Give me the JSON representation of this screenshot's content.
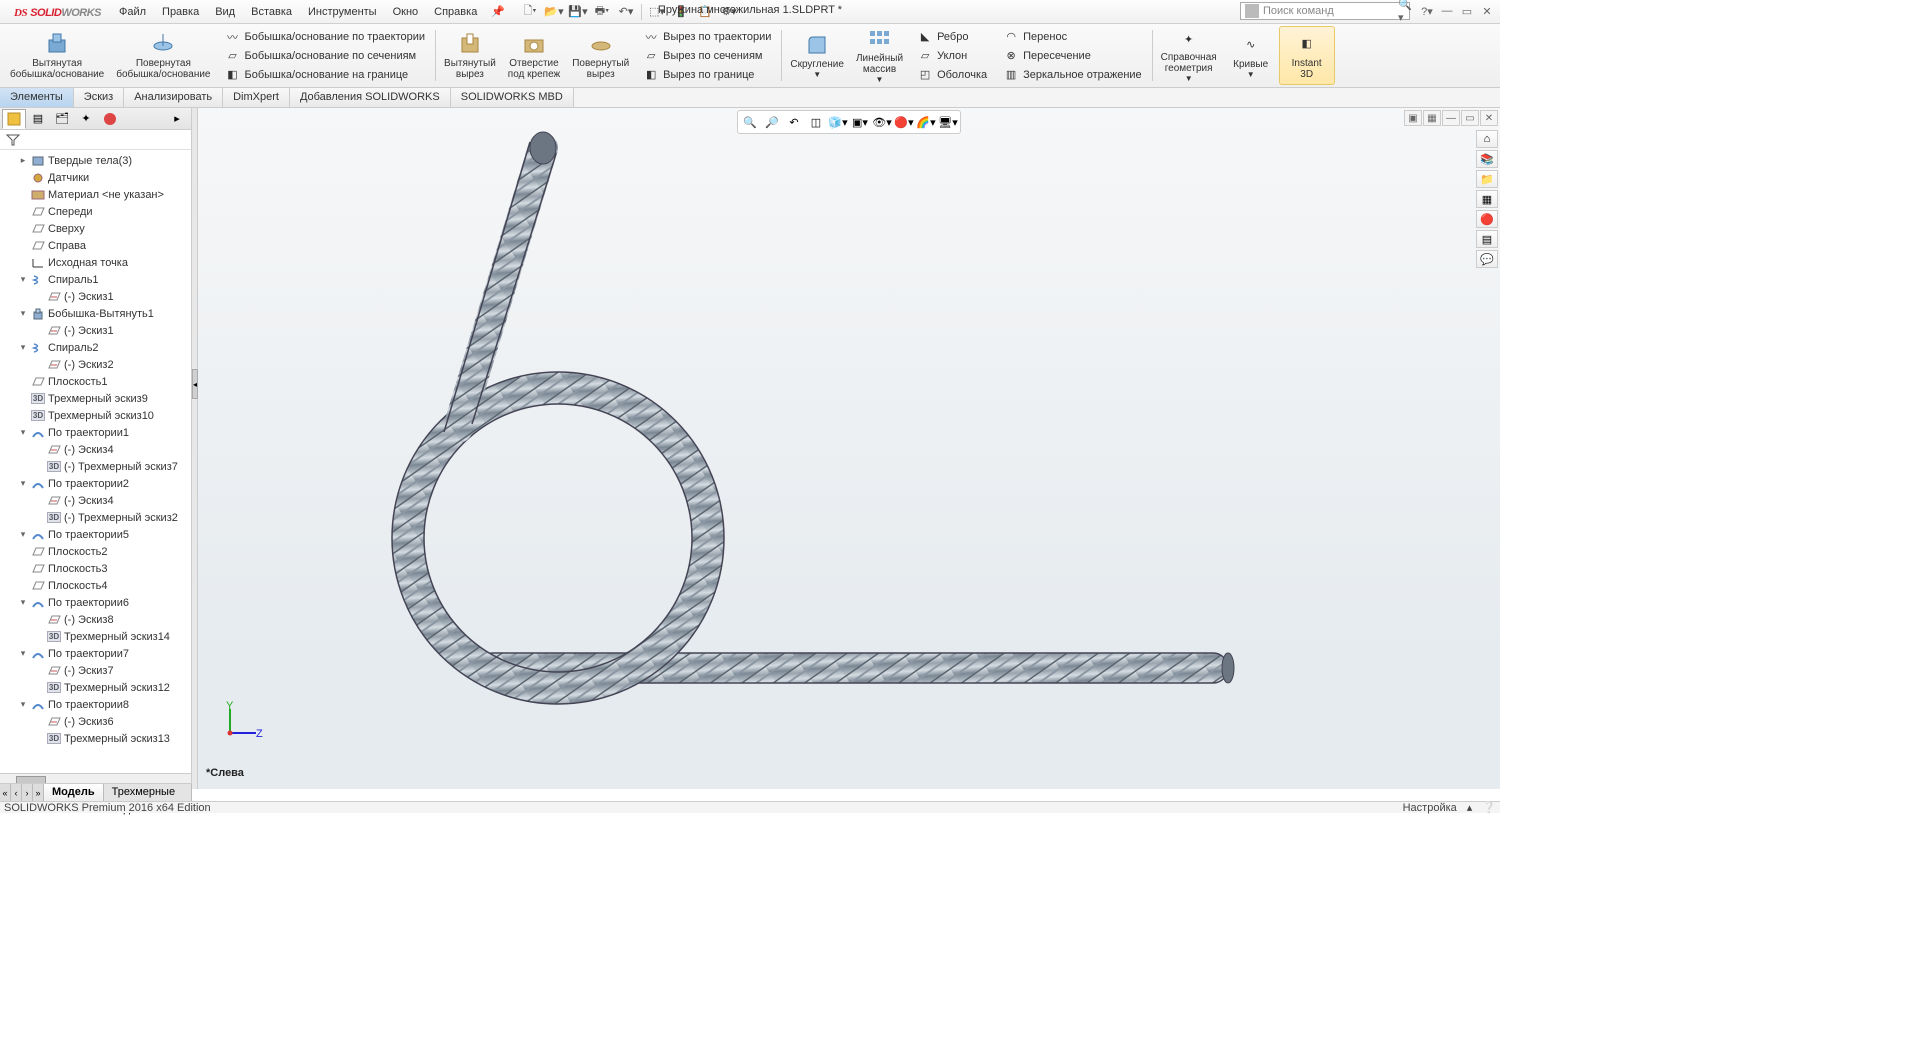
{
  "app": {
    "title": "Пружина многожильная 1.SLDPRT *",
    "logo_ds": "DS",
    "logo_solid": "SOLID",
    "logo_works": "WORKS"
  },
  "menu": [
    "Файл",
    "Правка",
    "Вид",
    "Вставка",
    "Инструменты",
    "Окно",
    "Справка"
  ],
  "search_placeholder": "Поиск команд",
  "ribbon": {
    "big": [
      {
        "label": "Вытянутая\nбобышка/основание"
      },
      {
        "label": "Повернутая\nбобышка/основание"
      }
    ],
    "stack1": [
      "Бобышка/основание по траектории",
      "Бобышка/основание по сечениям",
      "Бобышка/основание на границе"
    ],
    "big2": [
      {
        "label": "Вытянутый\nвырез"
      },
      {
        "label": "Отверстие\nпод крепеж"
      },
      {
        "label": "Повернутый\nвырез"
      }
    ],
    "stack2": [
      "Вырез по траектории",
      "Вырез по сечениям",
      "Вырез по границе"
    ],
    "big3": [
      {
        "label": "Скругление"
      },
      {
        "label": "Линейный\nмассив"
      }
    ],
    "stack3": [
      "Ребро",
      "Уклон",
      "Оболочка"
    ],
    "stack4": [
      "Перенос",
      "Пересечение",
      "Зеркальное отражение"
    ],
    "big4": [
      {
        "label": "Справочная\nгеометрия"
      },
      {
        "label": "Кривые"
      },
      {
        "label": "Instant\n3D"
      }
    ]
  },
  "cmdtabs": [
    "Элементы",
    "Эскиз",
    "Анализировать",
    "DimXpert",
    "Добавления SOLIDWORKS",
    "SOLIDWORKS MBD"
  ],
  "tree": [
    {
      "lvl": 1,
      "exp": "▸",
      "icon": "cube",
      "label": "Твердые тела(3)"
    },
    {
      "lvl": 1,
      "exp": "",
      "icon": "sensor",
      "label": "Датчики"
    },
    {
      "lvl": 1,
      "exp": "",
      "icon": "mat",
      "label": "Материал <не указан>"
    },
    {
      "lvl": 1,
      "exp": "",
      "icon": "plane",
      "label": "Спереди"
    },
    {
      "lvl": 1,
      "exp": "",
      "icon": "plane",
      "label": "Сверху"
    },
    {
      "lvl": 1,
      "exp": "",
      "icon": "plane",
      "label": "Справа"
    },
    {
      "lvl": 1,
      "exp": "",
      "icon": "origin",
      "label": "Исходная точка"
    },
    {
      "lvl": 1,
      "exp": "▾",
      "icon": "helix",
      "label": "Спираль1"
    },
    {
      "lvl": 2,
      "exp": "",
      "icon": "sketch",
      "label": "(-) Эскиз1"
    },
    {
      "lvl": 1,
      "exp": "▾",
      "icon": "extr",
      "label": "Бобышка-Вытянуть1"
    },
    {
      "lvl": 2,
      "exp": "",
      "icon": "sketch",
      "label": "(-) Эскиз1"
    },
    {
      "lvl": 1,
      "exp": "▾",
      "icon": "helix",
      "label": "Спираль2"
    },
    {
      "lvl": 2,
      "exp": "",
      "icon": "sketch",
      "label": "(-) Эскиз2"
    },
    {
      "lvl": 1,
      "exp": "",
      "icon": "plane",
      "label": "Плоскость1"
    },
    {
      "lvl": 1,
      "exp": "",
      "icon": "3d",
      "label": "Трехмерный эскиз9"
    },
    {
      "lvl": 1,
      "exp": "",
      "icon": "3d",
      "label": "Трехмерный эскиз10"
    },
    {
      "lvl": 1,
      "exp": "▾",
      "icon": "sweep",
      "label": "По траектории1"
    },
    {
      "lvl": 2,
      "exp": "",
      "icon": "sketch",
      "label": "(-) Эскиз4"
    },
    {
      "lvl": 2,
      "exp": "",
      "icon": "3d",
      "label": "(-) Трехмерный эскиз7"
    },
    {
      "lvl": 1,
      "exp": "▾",
      "icon": "sweep",
      "label": "По траектории2"
    },
    {
      "lvl": 2,
      "exp": "",
      "icon": "sketch",
      "label": "(-) Эскиз4"
    },
    {
      "lvl": 2,
      "exp": "",
      "icon": "3d",
      "label": "(-) Трехмерный эскиз2"
    },
    {
      "lvl": 1,
      "exp": "▾",
      "icon": "sweep",
      "label": "По траектории5"
    },
    {
      "lvl": 1,
      "exp": "",
      "icon": "plane",
      "label": "Плоскость2"
    },
    {
      "lvl": 1,
      "exp": "",
      "icon": "plane",
      "label": "Плоскость3"
    },
    {
      "lvl": 1,
      "exp": "",
      "icon": "plane",
      "label": "Плоскость4"
    },
    {
      "lvl": 1,
      "exp": "▾",
      "icon": "sweep",
      "label": "По траектории6"
    },
    {
      "lvl": 2,
      "exp": "",
      "icon": "sketch",
      "label": "(-) Эскиз8"
    },
    {
      "lvl": 2,
      "exp": "",
      "icon": "3d",
      "label": "Трехмерный эскиз14"
    },
    {
      "lvl": 1,
      "exp": "▾",
      "icon": "sweep",
      "label": "По траектории7"
    },
    {
      "lvl": 2,
      "exp": "",
      "icon": "sketch",
      "label": "(-) Эскиз7"
    },
    {
      "lvl": 2,
      "exp": "",
      "icon": "3d",
      "label": "Трехмерный эскиз12"
    },
    {
      "lvl": 1,
      "exp": "▾",
      "icon": "sweep",
      "label": "По траектории8"
    },
    {
      "lvl": 2,
      "exp": "",
      "icon": "sketch",
      "label": "(-) Эскиз6"
    },
    {
      "lvl": 2,
      "exp": "",
      "icon": "3d",
      "label": "Трехмерный эскиз13"
    }
  ],
  "bottom_tabs": [
    "Модель",
    "Трехмерные виды"
  ],
  "viewport_label": "Слева",
  "status_left": "SOLIDWORKS Premium 2016 x64 Edition",
  "status_right": "Настройка"
}
